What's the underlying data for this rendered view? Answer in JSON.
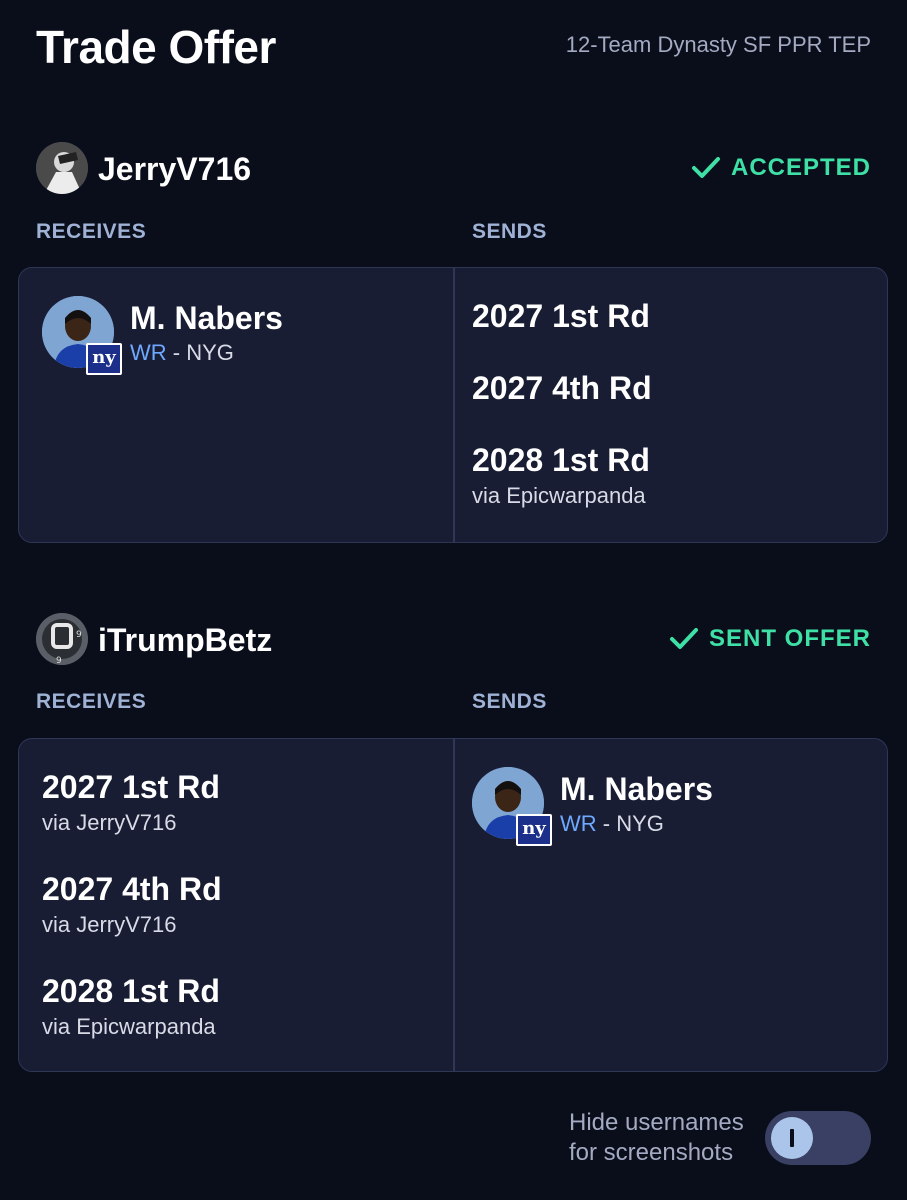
{
  "header": {
    "title": "Trade Offer",
    "league": "12-Team Dynasty SF PPR TEP"
  },
  "teams": [
    {
      "username": "JerryV716",
      "status": "ACCEPTED",
      "receives_label": "RECEIVES",
      "sends_label": "SENDS",
      "receives": [
        {
          "player_name": "M. Nabers",
          "position": "WR",
          "team": "- NYG",
          "team_logo": "ny"
        }
      ],
      "sends": [
        {
          "name": "2027 1st Rd",
          "via": ""
        },
        {
          "name": "2027 4th Rd",
          "via": ""
        },
        {
          "name": "2028 1st Rd",
          "via": "via Epicwarpanda"
        }
      ]
    },
    {
      "username": "iTrumpBetz",
      "status": "SENT OFFER",
      "receives_label": "RECEIVES",
      "sends_label": "SENDS",
      "receives": [
        {
          "name": "2027 1st Rd",
          "via": "via JerryV716"
        },
        {
          "name": "2027 4th Rd",
          "via": "via JerryV716"
        },
        {
          "name": "2028 1st Rd",
          "via": "via Epicwarpanda"
        }
      ],
      "sends": [
        {
          "player_name": "M. Nabers",
          "position": "WR",
          "team": "- NYG",
          "team_logo": "ny"
        }
      ]
    }
  ],
  "footer": {
    "hide_usernames_label": "Hide usernames for screenshots",
    "toggle_on": false
  },
  "colors": {
    "background": "#0a0e1a",
    "panel": "#181d33",
    "status_green": "#3ee0a6",
    "position_blue": "#6ea8ff",
    "section_label": "#9fb2d6"
  },
  "icons": [
    "check-icon",
    "avatar-icon",
    "team-logo-icon",
    "toggle-knob-icon"
  ]
}
